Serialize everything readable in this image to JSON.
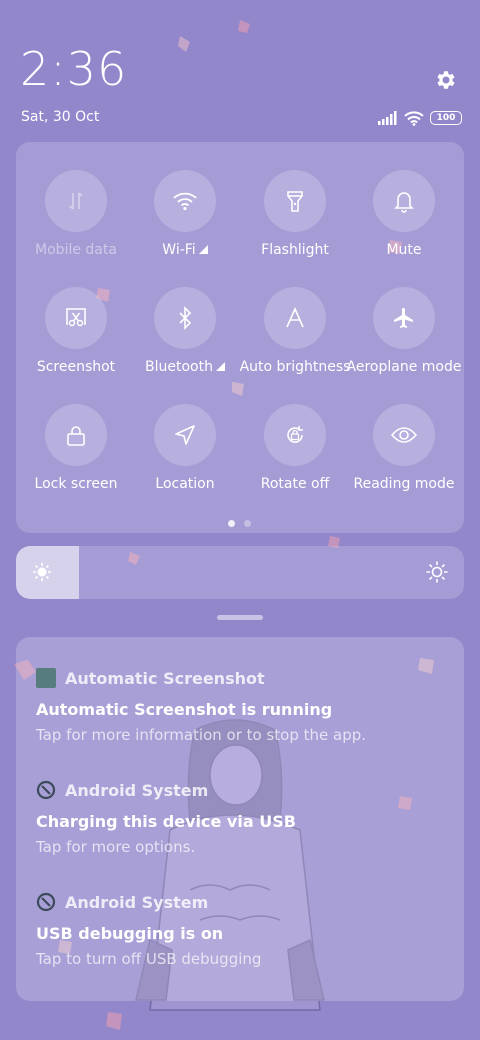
{
  "status": {
    "time": "2:36",
    "date": "Sat, 30 Oct",
    "battery": "100"
  },
  "quick_settings": {
    "tiles": [
      {
        "label": "Mobile data",
        "icon": "mobile-data-icon",
        "enabled": false
      },
      {
        "label": "Wi-Fi",
        "icon": "wifi-icon",
        "enabled": true
      },
      {
        "label": "Flashlight",
        "icon": "flashlight-icon",
        "enabled": true
      },
      {
        "label": "Mute",
        "icon": "bell-icon",
        "enabled": true
      },
      {
        "label": "Screenshot",
        "icon": "screenshot-icon",
        "enabled": true
      },
      {
        "label": "Bluetooth",
        "icon": "bluetooth-icon",
        "enabled": true
      },
      {
        "label": "Auto brightness",
        "icon": "auto-brightness-icon",
        "enabled": true
      },
      {
        "label": "Aeroplane mode",
        "icon": "airplane-icon",
        "enabled": true
      },
      {
        "label": "Lock screen",
        "icon": "lock-icon",
        "enabled": true
      },
      {
        "label": "Location",
        "icon": "location-icon",
        "enabled": true
      },
      {
        "label": "Rotate off",
        "icon": "rotate-lock-icon",
        "enabled": true
      },
      {
        "label": "Reading mode",
        "icon": "eye-icon",
        "enabled": true
      }
    ],
    "page_count": 2,
    "current_page": 1
  },
  "brightness": {
    "level_fraction": 0.14
  },
  "notifications": [
    {
      "app": "Automatic Screenshot",
      "title": "Automatic Screenshot is running",
      "text": "Tap for more information or to stop the app."
    },
    {
      "app": "Android System",
      "title": "Charging this device via USB",
      "text": "Tap for more options."
    },
    {
      "app": "Android System",
      "title": "USB debugging is on",
      "text": "Tap to turn off USB debugging"
    }
  ],
  "colors": {
    "background": "#9387cc",
    "app_icon_automatic_screenshot": "#567c7e"
  }
}
